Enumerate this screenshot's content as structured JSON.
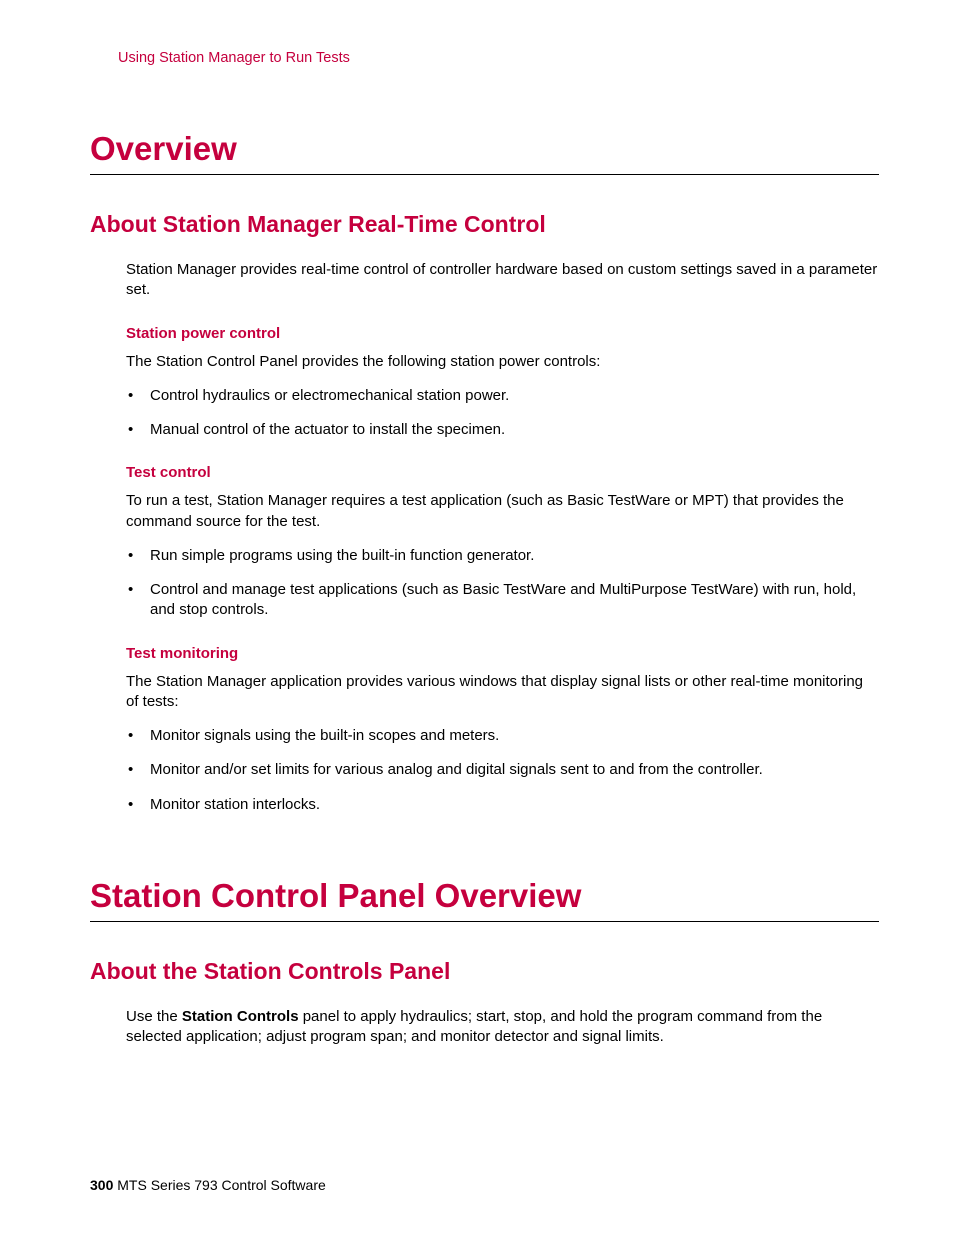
{
  "header": {
    "breadcrumb": "Using Station Manager to Run Tests"
  },
  "section1": {
    "title": "Overview",
    "subsection1": {
      "title": "About Station Manager Real-Time Control",
      "intro": "Station Manager provides real-time control of controller hardware based on custom settings saved in a parameter set.",
      "group1": {
        "title": "Station power control",
        "intro": "The Station Control Panel provides the following station power controls:",
        "items": [
          "Control hydraulics or electromechanical station power.",
          "Manual control of the actuator to install the specimen."
        ]
      },
      "group2": {
        "title": "Test control",
        "intro": "To run a test, Station Manager requires a test application (such as Basic TestWare or MPT) that provides the command source for the test.",
        "items": [
          "Run simple programs using the built-in function generator.",
          "Control and manage test applications (such as Basic TestWare and MultiPurpose TestWare) with run, hold, and stop controls."
        ]
      },
      "group3": {
        "title": "Test monitoring",
        "intro": "The Station Manager application provides various windows that display signal lists or other real-time monitoring of tests:",
        "items": [
          "Monitor signals using the built-in scopes and meters.",
          "Monitor and/or set limits for various analog and digital signals sent to and from the controller.",
          "Monitor station interlocks."
        ]
      }
    }
  },
  "section2": {
    "title": "Station Control Panel Overview",
    "subsection1": {
      "title": "About the Station Controls Panel",
      "intro_prefix": "Use the ",
      "intro_bold": "Station Controls",
      "intro_suffix": " panel to apply hydraulics; start, stop, and hold the program command from the selected application; adjust program span; and monitor detector and signal limits."
    }
  },
  "footer": {
    "page_num": "300",
    "doc_title": "MTS Series 793 Control Software"
  }
}
